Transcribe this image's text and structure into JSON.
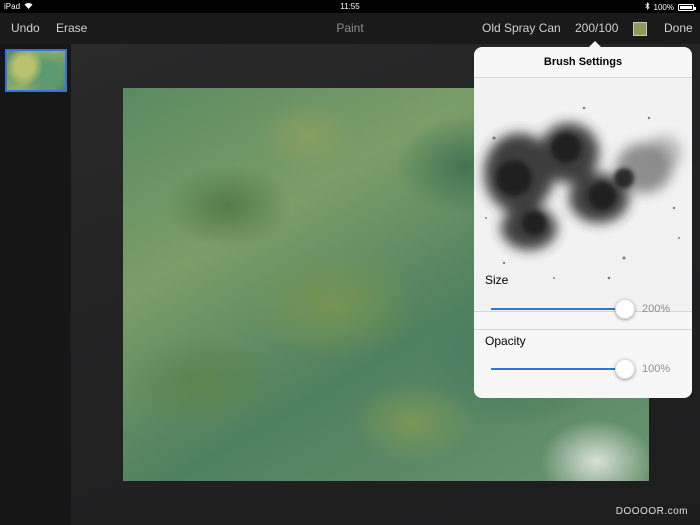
{
  "status": {
    "device": "iPad",
    "time": "11:55",
    "battery": "100%"
  },
  "toolbar": {
    "undo": "Undo",
    "erase": "Erase",
    "title": "Paint",
    "brush_name": "Old Spray Can",
    "brush_count": "200/100",
    "done": "Done",
    "current_color": "#8a9c5c"
  },
  "brush_settings": {
    "title": "Brush Settings",
    "size": {
      "label": "Size",
      "value": "200%",
      "level": 1.0
    },
    "opacity": {
      "label": "Opacity",
      "value": "100%",
      "level": 1.0
    }
  },
  "watermark": "DOOOOR.com",
  "colors": {
    "accent": "#2f74d6",
    "selection": "#3b6fe0"
  }
}
